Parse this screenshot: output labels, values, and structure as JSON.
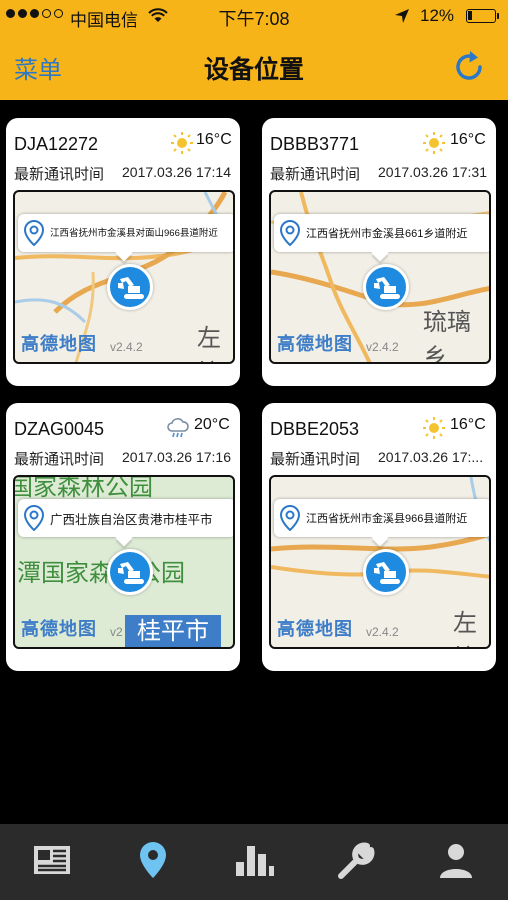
{
  "status_bar": {
    "carrier": "中国电信",
    "time": "下午7:08",
    "battery": "12%"
  },
  "header": {
    "menu_label": "菜单",
    "title": "设备位置",
    "refresh_icon": "refresh-icon"
  },
  "cards": [
    {
      "id": "DJA12272",
      "weather_icon": "sunny-icon",
      "temp": "16°C",
      "comm_label": "最新通讯时间",
      "comm_time": "2017.03.26 17:14",
      "address": "江西省抚州市金溪县对面山966县道附近",
      "map_logo": "高德地图",
      "map_version": "v2.4.2",
      "map_label": "左垃"
    },
    {
      "id": "DBBB3771",
      "weather_icon": "sunny-icon",
      "temp": "16°C",
      "comm_label": "最新通讯时间",
      "comm_time": "2017.03.26 17:31",
      "address": "江西省抚州市金溪县661乡道附近",
      "map_logo": "高德地图",
      "map_version": "v2.4.2",
      "map_label": "琉璃乡"
    },
    {
      "id": "DZAG0045",
      "weather_icon": "rainy-icon",
      "temp": "20°C",
      "comm_label": "最新通讯时间",
      "comm_time": "2017.03.26 17:16",
      "address": "广西壮族自治区贵港市桂平市",
      "map_logo": "高德地图",
      "map_version": "v2",
      "map_label": "潭国家森林公园",
      "map_label_top": "国家森林公园",
      "map_label_city": "桂平市"
    },
    {
      "id": "DBBE2053",
      "weather_icon": "sunny-icon",
      "temp": "16°C",
      "comm_label": "最新通讯时间",
      "comm_time": "2017.03.26 17:...",
      "address": "江西省抚州市金溪县966县道附近",
      "map_logo": "高德地图",
      "map_version": "v2.4.2",
      "map_label": "左垃"
    }
  ],
  "tabs": [
    {
      "icon": "news-icon",
      "active": false
    },
    {
      "icon": "location-pin-icon",
      "active": true
    },
    {
      "icon": "bar-chart-icon",
      "active": false
    },
    {
      "icon": "wrench-icon",
      "active": false
    },
    {
      "icon": "person-icon",
      "active": false
    }
  ],
  "colors": {
    "header_bg": "#F7B419",
    "accent_blue": "#2C78C8",
    "marker_blue": "#1E8BE0",
    "tabbar_bg": "#2B2B2B"
  }
}
